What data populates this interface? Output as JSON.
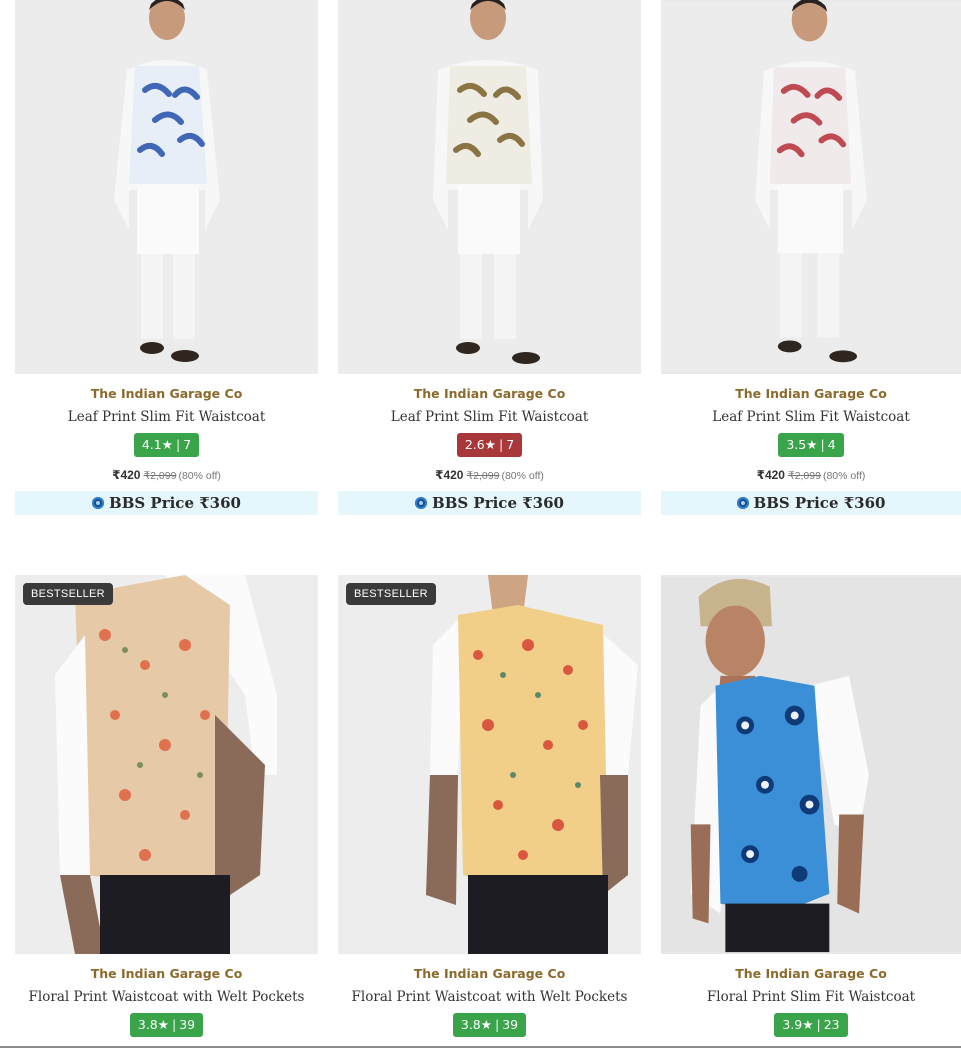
{
  "colors": {
    "rating_green": "#3aa44a",
    "rating_red": "#a8383a",
    "brand_text": "#8b6a2b",
    "bbs_bg": "#e5f6fd",
    "badge_bg": "#3a3a3a"
  },
  "products": [
    {
      "brand": "The Indian Garage Co",
      "name": "Leaf Print Slim Fit Waistcoat",
      "rating": "4.1",
      "star": "★",
      "sep": "|",
      "reviews": "7",
      "rating_color": "green",
      "price": "₹420",
      "mrp": "₹2,099",
      "discount": "(80% off)",
      "bbs_price": "BBS Price ₹360",
      "image": "model wearing blue leaf print waistcoat over white kurta"
    },
    {
      "brand": "The Indian Garage Co",
      "name": "Leaf Print Slim Fit Waistcoat",
      "rating": "2.6",
      "star": "★",
      "sep": "|",
      "reviews": "7",
      "rating_color": "red",
      "price": "₹420",
      "mrp": "₹2,099",
      "discount": "(80% off)",
      "bbs_price": "BBS Price ₹360",
      "image": "model wearing brown leaf print waistcoat over white kurta"
    },
    {
      "brand": "The Indian Garage Co",
      "name": "Leaf Print Slim Fit Waistcoat",
      "rating": "3.5",
      "star": "★",
      "sep": "|",
      "reviews": "4",
      "rating_color": "green",
      "price": "₹420",
      "mrp": "₹2,099",
      "discount": "(80% off)",
      "bbs_price": "BBS Price ₹360",
      "image": "model wearing red leaf print waistcoat over white kurta"
    },
    {
      "badge": "BESTSELLER",
      "brand": "The Indian Garage Co",
      "name": "Floral Print Waistcoat with Welt Pockets",
      "rating": "3.8",
      "star": "★",
      "sep": "|",
      "reviews": "39",
      "rating_color": "green",
      "image": "beige floral print waistcoat with white shirt"
    },
    {
      "badge": "BESTSELLER",
      "brand": "The Indian Garage Co",
      "name": "Floral Print Waistcoat with Welt Pockets",
      "rating": "3.8",
      "star": "★",
      "sep": "|",
      "reviews": "39",
      "rating_color": "green",
      "image": "yellow floral print waistcoat with white shirt"
    },
    {
      "brand": "The Indian Garage Co",
      "name": "Floral Print Slim Fit Waistcoat",
      "rating": "3.9",
      "star": "★",
      "sep": "|",
      "reviews": "23",
      "rating_color": "green",
      "image": "model wearing blue floral print waistcoat with white shirt"
    }
  ]
}
